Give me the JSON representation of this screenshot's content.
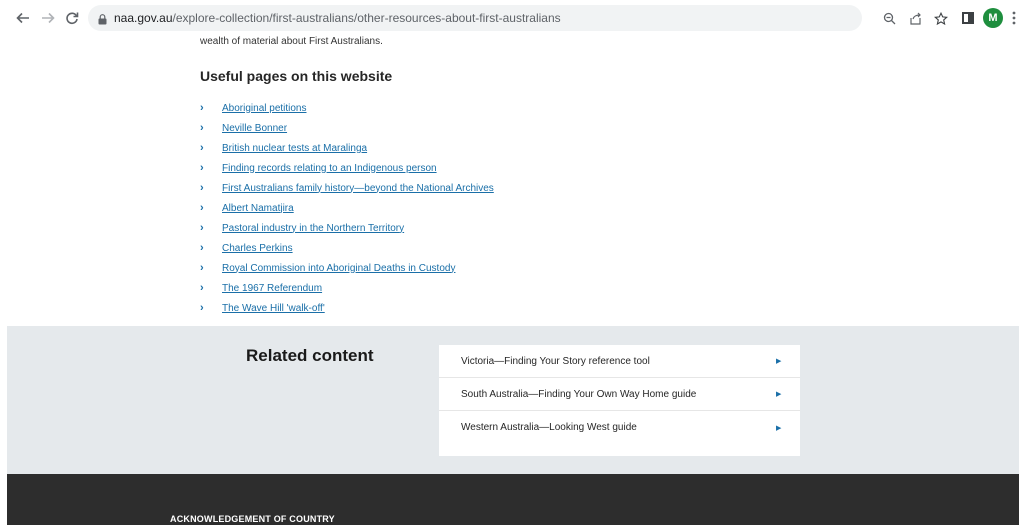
{
  "browser": {
    "url_host": "naa.gov.au",
    "url_path": "/explore-collection/first-australians/other-resources-about-first-australians",
    "avatar_letter": "M"
  },
  "main": {
    "intro_text": "wealth of material about First Australians.",
    "useful_heading": "Useful pages on this website",
    "links": [
      {
        "label": "Aboriginal petitions"
      },
      {
        "label": "Neville Bonner"
      },
      {
        "label": "British nuclear tests at Maralinga"
      },
      {
        "label": "Finding records relating to an Indigenous person"
      },
      {
        "label": "First Australians family history—beyond the National Archives"
      },
      {
        "label": "Albert Namatjira"
      },
      {
        "label": "Pastoral industry in the Northern Territory"
      },
      {
        "label": "Charles Perkins"
      },
      {
        "label": "Royal Commission into Aboriginal Deaths in Custody"
      },
      {
        "label": "The 1967 Referendum"
      },
      {
        "label": "The Wave Hill 'walk-off'"
      }
    ]
  },
  "related": {
    "title": "Related content",
    "items": [
      {
        "label": "Victoria—Finding Your Story reference tool"
      },
      {
        "label": "South Australia—Finding Your Own Way Home guide"
      },
      {
        "label": "Western Australia—Looking West guide"
      }
    ]
  },
  "footer": {
    "ack_heading": "ACKNOWLEDGEMENT OF COUNTRY"
  },
  "colors": {
    "link": "#1a6fa8",
    "band": "#e5e9ec",
    "footer": "#2d2d2d",
    "avatar": "#1e8e3e"
  }
}
